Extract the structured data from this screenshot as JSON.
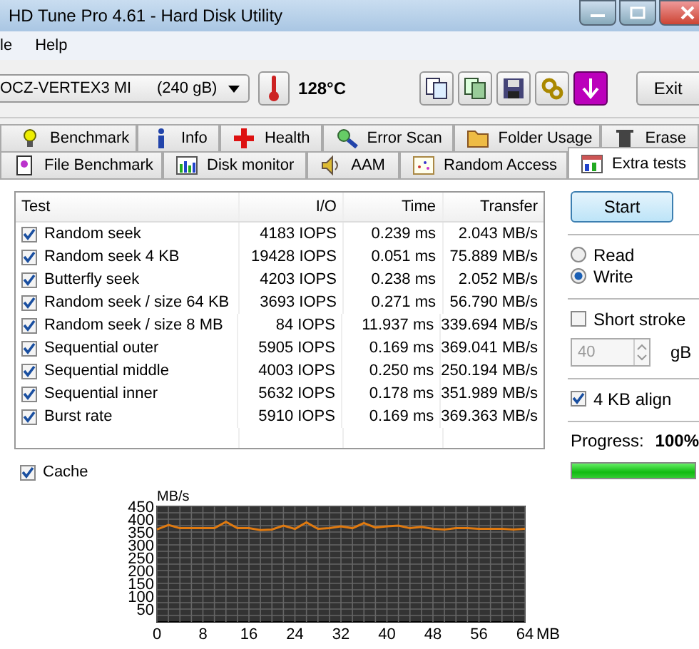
{
  "window": {
    "title": "HD Tune Pro 4.61 - Hard Disk Utility"
  },
  "menu": [
    {
      "label": "le"
    },
    {
      "label": "Help"
    }
  ],
  "toolbar": {
    "drive": "OCZ-VERTEX3 MI",
    "capacity": "(240 gB)",
    "temperature": "128°C",
    "exit": "Exit"
  },
  "tabs_row_1": [
    {
      "label": "Benchmark",
      "selected": false
    },
    {
      "label": "Info",
      "selected": false
    },
    {
      "label": "Health",
      "selected": false
    },
    {
      "label": "Error Scan",
      "selected": false
    },
    {
      "label": "Folder Usage",
      "selected": false
    },
    {
      "label": "Erase",
      "selected": false
    }
  ],
  "tabs_row_2": [
    {
      "label": "File Benchmark",
      "selected": false
    },
    {
      "label": "Disk monitor",
      "selected": false
    },
    {
      "label": "AAM",
      "selected": false
    },
    {
      "label": "Random Access",
      "selected": false
    },
    {
      "label": "Extra tests",
      "selected": true
    }
  ],
  "table": {
    "columns": [
      "Test",
      "I/O",
      "Time",
      "Transfer"
    ],
    "rows": [
      {
        "checked": true,
        "test": "Random seek",
        "io": "4183 IOPS",
        "time": "0.239 ms",
        "transfer": "2.043 MB/s"
      },
      {
        "checked": true,
        "test": "Random seek 4 KB",
        "io": "19428 IOPS",
        "time": "0.051 ms",
        "transfer": "75.889 MB/s"
      },
      {
        "checked": true,
        "test": "Butterfly seek",
        "io": "4203 IOPS",
        "time": "0.238 ms",
        "transfer": "2.052 MB/s"
      },
      {
        "checked": true,
        "test": "Random seek / size 64 KB",
        "io": "3693 IOPS",
        "time": "0.271 ms",
        "transfer": "56.790 MB/s"
      },
      {
        "checked": true,
        "test": "Random seek / size 8 MB",
        "io": "84 IOPS",
        "time": "11.937 ms",
        "transfer": "339.694 MB/s"
      },
      {
        "checked": true,
        "test": "Sequential outer",
        "io": "5905 IOPS",
        "time": "0.169 ms",
        "transfer": "369.041 MB/s"
      },
      {
        "checked": true,
        "test": "Sequential middle",
        "io": "4003 IOPS",
        "time": "0.250 ms",
        "transfer": "250.194 MB/s"
      },
      {
        "checked": true,
        "test": "Sequential inner",
        "io": "5632 IOPS",
        "time": "0.178 ms",
        "transfer": "351.989 MB/s"
      },
      {
        "checked": true,
        "test": "Burst rate",
        "io": "5910 IOPS",
        "time": "0.169 ms",
        "transfer": "369.363 MB/s"
      }
    ]
  },
  "cache": {
    "label": "Cache",
    "checked": true
  },
  "side": {
    "start": "Start",
    "modes": [
      {
        "label": "Read",
        "selected": false
      },
      {
        "label": "Write",
        "selected": true
      }
    ],
    "short_stroke": {
      "label": "Short stroke",
      "checked": false
    },
    "stroke_size": {
      "value": "40",
      "unit": "gB",
      "disabled": true
    },
    "align": {
      "label": "4 KB align",
      "checked": true
    },
    "progress": {
      "label": "Progress:",
      "reading": "100%",
      "level": 1
    }
  },
  "chart": {
    "chart_data": {
      "type": "line",
      "xlabel": "MB",
      "ylabel": "MB/s",
      "xlim": [
        0,
        64
      ],
      "ylim": [
        0,
        450
      ],
      "xticks": [
        0,
        8,
        16,
        24,
        32,
        40,
        48,
        56,
        64
      ],
      "yticks": [
        50,
        100,
        150,
        200,
        250,
        300,
        350,
        400,
        450
      ],
      "x": [
        0,
        2,
        4,
        6,
        8,
        10,
        12,
        14,
        16,
        18,
        20,
        22,
        24,
        26,
        28,
        30,
        32,
        34,
        36,
        38,
        40,
        42,
        44,
        46,
        48,
        50,
        52,
        54,
        56,
        58,
        60,
        62,
        64
      ],
      "grid": true,
      "series": [
        {
          "color": "#e07a10",
          "values": [
            360,
            378,
            365,
            365,
            365,
            365,
            390,
            365,
            365,
            358,
            360,
            375,
            362,
            388,
            362,
            365,
            372,
            365,
            385,
            368,
            372,
            375,
            365,
            370,
            362,
            360,
            365,
            365,
            362,
            363,
            362,
            360,
            362
          ]
        }
      ]
    }
  }
}
